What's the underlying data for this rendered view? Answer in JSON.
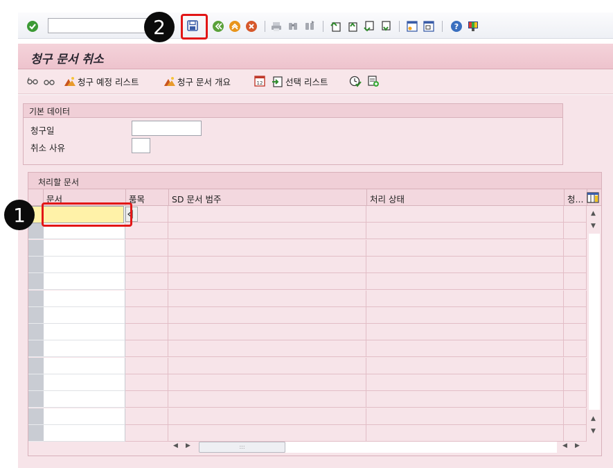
{
  "toolbar": {
    "command_field_value": "",
    "icons": [
      "enter-icon",
      "save-icon",
      "back-icon",
      "exit-icon",
      "cancel-icon",
      "print-icon",
      "find-icon",
      "find-next-icon",
      "first-page-icon",
      "previous-page-icon",
      "next-page-icon",
      "last-page-icon",
      "create-session-icon",
      "create-shortcut-icon",
      "help-icon",
      "customize-layout-icon"
    ]
  },
  "annotations": {
    "marker_1": "1",
    "marker_2": "2"
  },
  "title": "청구 문서 취소",
  "app_toolbar": {
    "billing_due_list": "청구 예정 리스트",
    "billing_doc_overview": "청구 문서 개요",
    "selection_list": "선택 리스트"
  },
  "basic_data": {
    "header": "기본 데이터",
    "billing_date_label": "청구일",
    "billing_date_value": "",
    "cancel_reason_label": "취소 사유",
    "cancel_reason_value": ""
  },
  "documents": {
    "header": "처리할 문서",
    "columns": [
      "문서",
      "품목",
      "SD 문서 범주",
      "처리 상태",
      "청..."
    ],
    "visible_rows": 14
  },
  "colors": {
    "title_bar": "#eec3cd",
    "panel_bg": "#f7e4e9",
    "active_input": "#fff2a8",
    "highlight_red": "#e21616"
  }
}
